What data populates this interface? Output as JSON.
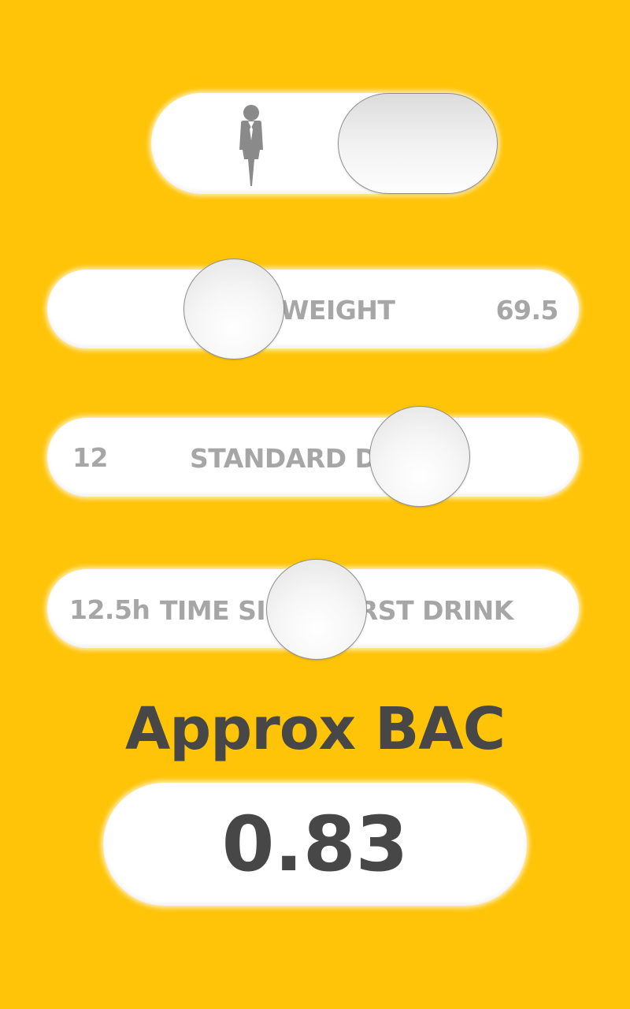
{
  "gender": {
    "icon": "male-person-icon",
    "selected": "male"
  },
  "weight": {
    "label": "WEIGHT",
    "value": "69.5"
  },
  "drinks": {
    "label": "STANDARD DRINKS",
    "value": "12"
  },
  "time": {
    "label": "TIME SINCE FIRST DRINK",
    "value": "12.5h"
  },
  "result": {
    "title": "Approx BAC",
    "value": "0.83"
  },
  "colors": {
    "background": "#FFC408",
    "text_dark": "#474747",
    "text_light": "#A6A6A6",
    "surface": "#FFFFFF"
  }
}
